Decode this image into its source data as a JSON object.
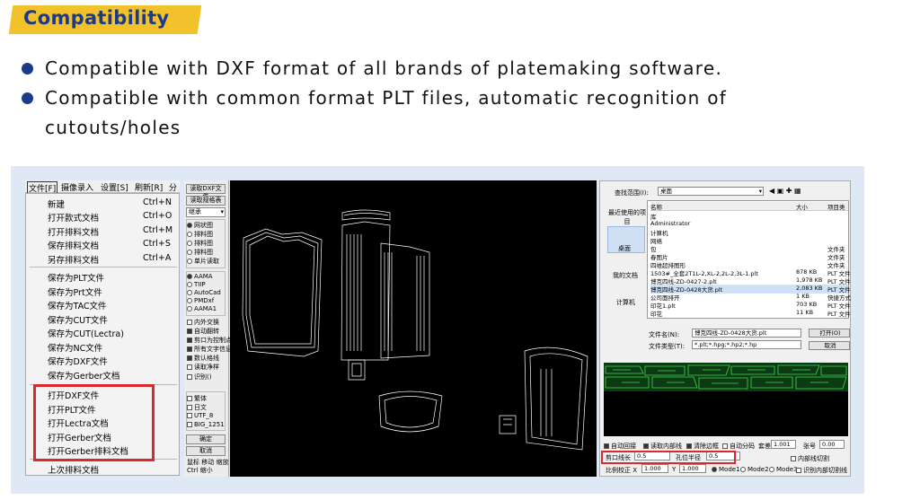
{
  "section_title": "Compatibility",
  "bullets": [
    "Compatible with DXF format of all brands of platemaking software.",
    "Compatible with common format PLT files, automatic recognition of",
    "cutouts/holes"
  ],
  "colors": {
    "accent": "#1b3a8c",
    "highlight": "#f2c22c",
    "callout": "#d9282f",
    "panel": "#dfe9f5"
  },
  "menubar": [
    "文件[F]",
    "摄像录入",
    "设置[S]",
    "刷新[R]",
    "分"
  ],
  "file_menu": {
    "items": [
      {
        "label": "新建",
        "shortcut": "Ctrl+N"
      },
      {
        "label": "打开款式文档",
        "shortcut": "Ctrl+O"
      },
      {
        "label": "打开排料文档",
        "shortcut": "Ctrl+M"
      },
      {
        "label": "保存排料文档",
        "shortcut": "Ctrl+S"
      },
      {
        "label": "另存排料文档",
        "shortcut": "Ctrl+A"
      },
      {
        "label": "保存为PLT文件",
        "shortcut": ""
      },
      {
        "label": "保存为Prt文件",
        "shortcut": ""
      },
      {
        "label": "保存为TAC文件",
        "shortcut": ""
      },
      {
        "label": "保存为CUT文件",
        "shortcut": ""
      },
      {
        "label": "保存为CUT(Lectra)",
        "shortcut": ""
      },
      {
        "label": "保存为NC文件",
        "shortcut": ""
      },
      {
        "label": "保存为DXF文件",
        "shortcut": ""
      },
      {
        "label": "保存为Gerber文档",
        "shortcut": ""
      },
      {
        "label": "打开DXF文件",
        "shortcut": ""
      },
      {
        "label": "打开PLT文件",
        "shortcut": ""
      },
      {
        "label": "打开Lectra文档",
        "shortcut": ""
      },
      {
        "label": "打开Gerber文档",
        "shortcut": ""
      },
      {
        "label": "打开Gerber排料文档",
        "shortcut": ""
      },
      {
        "label": "上次排料文档",
        "shortcut": ""
      }
    ]
  },
  "control_panel": {
    "read_dxf": "读取DXF文件",
    "read_spec": "读取规格表",
    "select_value": "继承",
    "view_radios": [
      "网状图",
      "排料图",
      "排料图",
      "排料图",
      "单片读取"
    ],
    "format_radios": [
      "AAMA",
      "TIIP",
      "AutoCad",
      "PMDxf",
      "AAMA1"
    ],
    "checks": [
      "内外交换",
      "自动翻转",
      "剪口为控制点",
      "所有文字信息",
      "数认格线",
      "读取净样",
      "识别()"
    ],
    "enc_checks": [
      "繁体",
      "日文",
      "UTF_8",
      "BIG_1251"
    ],
    "ok": "确定",
    "cancel": "取消",
    "hint1": "鼠标 移动 缩放",
    "hint2": "Ctrl 缩小"
  },
  "file_dialog": {
    "lookin_label": "查找范围(I):",
    "lookin_value": "桌面",
    "places": [
      "最近使用的项目",
      "桌面",
      "我的文档",
      "计算机"
    ],
    "columns": [
      "名称",
      "大小",
      "项目类"
    ],
    "rows": [
      {
        "name": "库",
        "size": "",
        "type": ""
      },
      {
        "name": "Administrator",
        "size": "",
        "type": ""
      },
      {
        "name": "计算机",
        "size": "",
        "type": ""
      },
      {
        "name": "网络",
        "size": "",
        "type": ""
      },
      {
        "name": "包",
        "size": "",
        "type": "文件夹"
      },
      {
        "name": "春图片",
        "size": "",
        "type": "文件夹"
      },
      {
        "name": "四维超排图形",
        "size": "",
        "type": "文件夹"
      },
      {
        "name": "1503#_全套2T1L-2,XL-2,2L-2,3L-1.plt",
        "size": "878 KB",
        "type": "PLT 文件"
      },
      {
        "name": "博克四线-ZD-0427-2.plt",
        "size": "1,978 KB",
        "type": "PLT 文件"
      },
      {
        "name": "博克四线-ZD-0428大货.plt",
        "size": "2,083 KB",
        "type": "PLT 文件"
      },
      {
        "name": "公司面排开",
        "size": "1 KB",
        "type": "快捷方式"
      },
      {
        "name": "印花1.plt",
        "size": "703 KB",
        "type": "PLT 文件"
      },
      {
        "name": "印花",
        "size": "11 KB",
        "type": "PLT 文件"
      }
    ],
    "filename_label": "文件名(N):",
    "filename_value": "博克四线-ZD-0428大货.plt",
    "filetype_label": "文件类型(T):",
    "filetype_value": "*.plt;*.hpg;*.hp2;*.hp",
    "open": "打开(O)",
    "cancel": "取消",
    "opt_checks": [
      "自动回接",
      "读取内部线",
      "清除边框",
      "自动分码"
    ],
    "ratio_label": "套差",
    "ratio_value": "1.001",
    "copies_label": "张号",
    "copies_value": "0.00",
    "notch_label": "剪口线长",
    "notch_value": "0.5",
    "hole_label": "孔位半径",
    "hole_value": "0.5",
    "scale_label": "比例校正 X",
    "scale_x": "1.000",
    "scale_y_label": "Y",
    "scale_y": "1.000",
    "modes": [
      "Mode1",
      "Mode2",
      "Mode3"
    ],
    "inner_cut": "内部线切割",
    "recognize": "识别内部切割线"
  }
}
